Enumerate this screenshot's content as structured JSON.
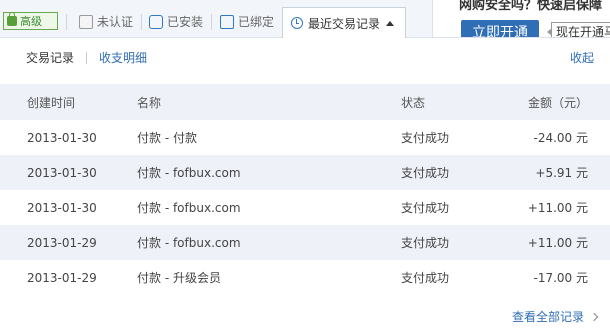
{
  "header": {
    "level_badge": "高级",
    "tabs": [
      {
        "label": "未认证"
      },
      {
        "label": "已安装"
      },
      {
        "label": "已绑定"
      }
    ],
    "active_tab": "最近交易记录",
    "promo_text": "网购安全吗？快速启保障",
    "open_button": "立即开通",
    "tooltip": "现在开通马"
  },
  "subnav": {
    "active": "交易记录",
    "other": "收支明细",
    "collapse": "收起"
  },
  "table": {
    "headers": {
      "date": "创建时间",
      "name": "名称",
      "status": "状态",
      "amount": "金额（元）"
    },
    "rows": [
      {
        "date": "2013-01-30",
        "name": "付款 - 付款",
        "status": "支付成功",
        "amount": "-24.00 元"
      },
      {
        "date": "2013-01-30",
        "name": "付款 - fofbux.com",
        "status": "支付成功",
        "amount": "+5.91 元"
      },
      {
        "date": "2013-01-30",
        "name": "付款 - fofbux.com",
        "status": "支付成功",
        "amount": "+11.00 元"
      },
      {
        "date": "2013-01-29",
        "name": "付款 - fofbux.com",
        "status": "支付成功",
        "amount": "+11.00 元"
      },
      {
        "date": "2013-01-29",
        "name": "付款 - 升级会员",
        "status": "支付成功",
        "amount": "-17.00 元"
      }
    ]
  },
  "footer": {
    "view_all": "查看全部记录"
  }
}
